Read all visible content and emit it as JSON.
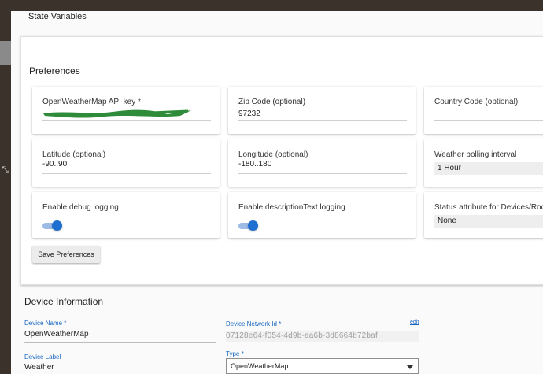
{
  "state_variables": {
    "title": "State Variables"
  },
  "preferences": {
    "title": "Preferences",
    "api_key": {
      "label": "OpenWeatherMap API key *",
      "value": ""
    },
    "zip": {
      "label": "Zip Code (optional)",
      "value": "97232"
    },
    "country": {
      "label": "Country Code (optional)",
      "value": ""
    },
    "latitude": {
      "label": "Latitude (optional)",
      "value": "-90..90"
    },
    "longitude": {
      "label": "Longitude (optional)",
      "value": "-180..180"
    },
    "polling": {
      "label": "Weather polling interval",
      "value": "1 Hour"
    },
    "debug": {
      "label": "Enable debug logging",
      "on": true
    },
    "desc_text": {
      "label": "Enable descriptionText logging",
      "on": true
    },
    "status_attr": {
      "label": "Status attribute for Devices/Rooms",
      "value": "None"
    },
    "save_label": "Save Preferences"
  },
  "device_info": {
    "title": "Device Information",
    "name": {
      "label": "Device Name *",
      "value": "OpenWeatherMap"
    },
    "network_id": {
      "label": "Device Network Id *",
      "value": "07128e64-f054-4d9b-aa6b-3d8664b72baf",
      "edit_label": "edit"
    },
    "device_label": {
      "label": "Device Label",
      "value": "Weather"
    },
    "type": {
      "label": "Type *",
      "value": "OpenWeatherMap"
    }
  },
  "colors": {
    "accent": "#1e6fd0",
    "link": "#1565c0",
    "sidebar": "#3a322b",
    "redaction": "#2e8b3a"
  }
}
